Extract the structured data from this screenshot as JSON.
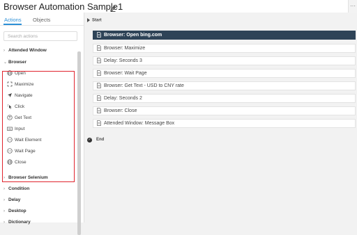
{
  "header": {
    "title": "Browser Automation Sample1",
    "edit_icon": "pencil-icon"
  },
  "left_panel": {
    "tabs": [
      {
        "label": "Actions",
        "active": true
      },
      {
        "label": "Objects",
        "active": false
      }
    ],
    "search": {
      "placeholder": "Search actions",
      "value": ""
    },
    "categories": {
      "attended_window": "Attended Window",
      "browser": "Browser",
      "browser_selenium": "Browser Selenium",
      "condition": "Condition",
      "delay": "Delay",
      "desktop": "Desktop",
      "dictionary": "Dictionary"
    },
    "browser_items": [
      {
        "label": "Open",
        "icon": "globe-icon"
      },
      {
        "label": "Maximize",
        "icon": "maximize-icon"
      },
      {
        "label": "Navigate",
        "icon": "navigate-arrow-icon"
      },
      {
        "label": "Click",
        "icon": "click-icon"
      },
      {
        "label": "Get Text",
        "icon": "get-text-icon"
      },
      {
        "label": "Input",
        "icon": "keyboard-icon"
      },
      {
        "label": "Wait Element",
        "icon": "wait-icon"
      },
      {
        "label": "Wait Page",
        "icon": "wait-icon"
      },
      {
        "label": "Close",
        "icon": "globe-icon"
      }
    ]
  },
  "flow": {
    "start_label": "Start",
    "end_label": "End",
    "steps": [
      {
        "label": "Browser: Open bing.com",
        "selected": true
      },
      {
        "label": "Browser: Maximize",
        "selected": false
      },
      {
        "label": "Delay: Seconds 3",
        "selected": false
      },
      {
        "label": "Browser: Wait Page",
        "selected": false
      },
      {
        "label": "Browser: Get Text - USD to CNY rate",
        "selected": false
      },
      {
        "label": "Delay: Seconds 2",
        "selected": false
      },
      {
        "label": "Browser: Close",
        "selected": false
      },
      {
        "label": "Attended Window: Message Box",
        "selected": false
      }
    ]
  },
  "colors": {
    "accent": "#2b8fd6",
    "selected_step": "#2e4357",
    "highlight_box": "#e0232d"
  }
}
